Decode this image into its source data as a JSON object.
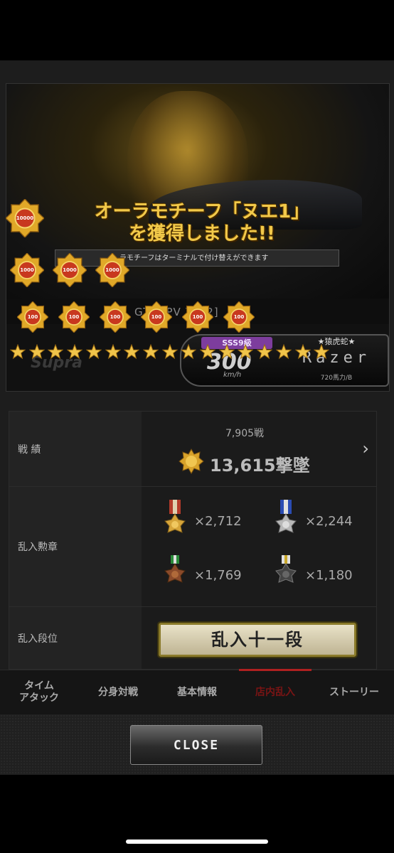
{
  "banner": {
    "headline_line1": "オーラモチーフ「ヌエ1」",
    "headline_line2": "を獲得しました!!",
    "note": "ラモチーフはターミナルで付け替えができます",
    "car_name": "GT-R  PV  Z  [  2]",
    "car_logo": "Supra"
  },
  "medal_row1_labels": [
    "10000"
  ],
  "medal_row2_labels": [
    "1000",
    "1000",
    "1000"
  ],
  "medal_row3_labels": [
    "100",
    "100",
    "100",
    "100",
    "100",
    "100"
  ],
  "star_count": 17,
  "speed_panel": {
    "rank_badge": "SSS9級",
    "speed": "300",
    "unit": "km/h",
    "title": "★猿虎蛇★",
    "driver": "Razer",
    "driver_sub": "720馬力/B"
  },
  "stats": {
    "record_label": "戦 績",
    "battles": "7,905戦",
    "kills": "13,615撃墜",
    "medals_label": "乱入勲章",
    "medals": [
      {
        "icon": "red-medal-icon",
        "count": "×2,712"
      },
      {
        "icon": "blue-medal-icon",
        "count": "×2,244"
      },
      {
        "icon": "green-medal-icon",
        "count": "×1,769"
      },
      {
        "icon": "white-medal-icon",
        "count": "×1,180"
      }
    ],
    "dan_label": "乱入段位",
    "dan_value": "乱入十一段"
  },
  "tabs": [
    {
      "label": "タイム\nアタック",
      "active": false
    },
    {
      "label": "分身対戦",
      "active": false
    },
    {
      "label": "基本情報",
      "active": false
    },
    {
      "label": "店内乱入",
      "active": true
    },
    {
      "label": "ストーリー",
      "active": false
    }
  ],
  "close_label": "CLOSE",
  "colors": {
    "gold": "#f2c94a",
    "active_tab": "#b02020",
    "rank_purple": "#7d3d9d"
  }
}
